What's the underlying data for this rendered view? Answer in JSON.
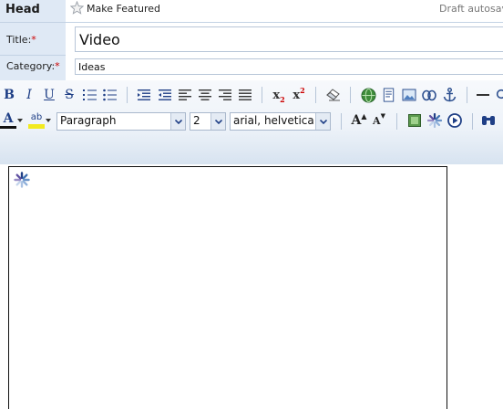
{
  "head": {
    "label": "Head",
    "make_featured": "Make Featured",
    "draft_status": "Draft autosave"
  },
  "fields": {
    "title_label": "Title:",
    "title_value": "Video",
    "category_label": "Category:",
    "category_value": "Ideas",
    "required_marker": "*"
  },
  "toolbar": {
    "bold": "B",
    "italic": "I",
    "underline": "U",
    "strikethrough": "S",
    "subscript_base": "x",
    "subscript_mark": "2",
    "superscript_base": "x",
    "superscript_mark": "2",
    "font_color_glyph": "A",
    "highlight_glyph": "ab",
    "block_format": "Paragraph",
    "font_size": "2",
    "font_family": "arial, helvetica, s",
    "grow_font": "A",
    "shrink_font": "A"
  },
  "colors": {
    "label_bg": "#dfe9f5",
    "toolbar_icon": "#1f3f86",
    "required": "#cc0000",
    "editor_border": "#111111"
  }
}
